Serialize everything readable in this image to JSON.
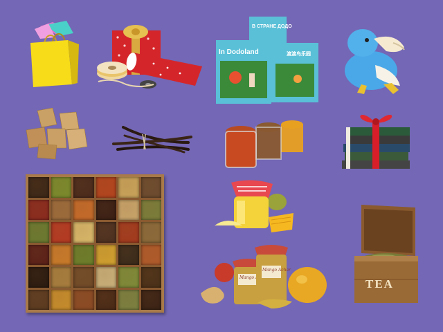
{
  "background_color": "#7467b5",
  "items": [
    {
      "name": "shopping-bag",
      "icon": "gift-bag-icon"
    },
    {
      "name": "gift-wrap-supplies",
      "icon": "gift-wrap-icon"
    },
    {
      "name": "dodo-books",
      "icon": "book-icon"
    },
    {
      "name": "dodo-plush",
      "icon": "plush-toy-icon"
    },
    {
      "name": "sugar-cubes",
      "icon": "sugar-icon"
    },
    {
      "name": "vanilla-pods",
      "icon": "vanilla-icon"
    },
    {
      "name": "spice-jars",
      "icon": "jar-icon"
    },
    {
      "name": "books-gift",
      "icon": "book-stack-icon"
    },
    {
      "name": "spice-box",
      "icon": "spice-box-icon"
    },
    {
      "name": "mango-jam",
      "icon": "jam-jar-icon"
    },
    {
      "name": "mango-chutney",
      "icon": "chutney-icon"
    },
    {
      "name": "tea-chest",
      "icon": "tea-box-icon"
    }
  ],
  "books": {
    "book1_title": "In Dodoland",
    "book2_title": "В СТРАНЕ ДОДО",
    "book3_title": "渡渡鸟乐园"
  },
  "jars": {
    "label1": "Mango Achar",
    "label2": "Mango Achar"
  },
  "tea_box": {
    "label": "TEA"
  },
  "spice_colors": [
    "#3b2616",
    "#7a8b2c",
    "#4a2a1c",
    "#b3441e",
    "#c9a35a",
    "#6b4a2e",
    "#8a2a1e",
    "#9c6b3c",
    "#c46a2a",
    "#3a1f14",
    "#c8a46a",
    "#7a7d3a",
    "#6a7a30",
    "#b43a22",
    "#d8b86a",
    "#4d3020",
    "#a33a1e",
    "#8b6a3a",
    "#5a2018",
    "#c87a2a",
    "#6b7e2a",
    "#d0a030",
    "#3a2a1a",
    "#b05a2a",
    "#2a1a10",
    "#a77d3e",
    "#704a28",
    "#c9b07a",
    "#7e8b38",
    "#4a3018",
    "#5a3a20",
    "#c68c2c",
    "#8a4a24",
    "#4a2a16",
    "#7a8040",
    "#3a2214"
  ]
}
